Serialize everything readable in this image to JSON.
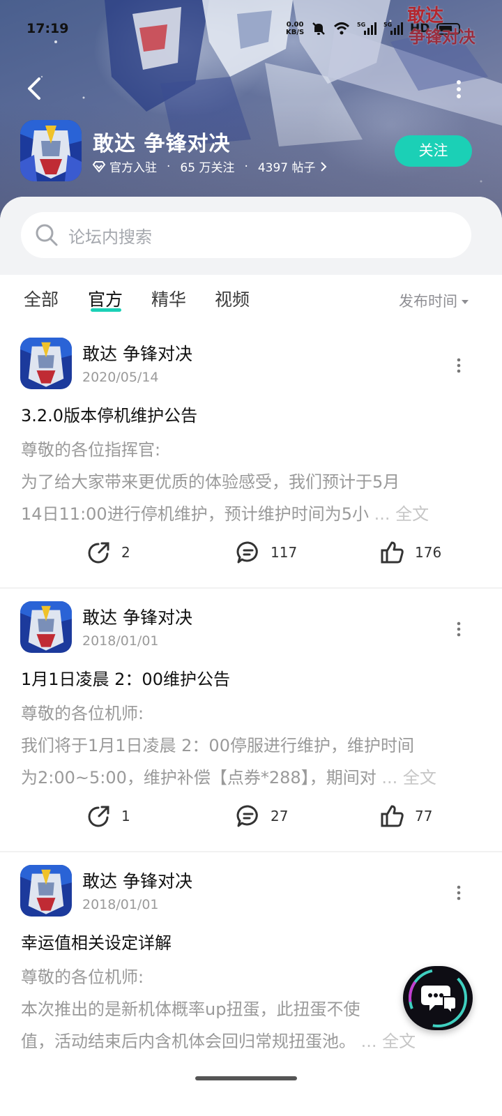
{
  "status": {
    "time": "17:19",
    "net_speed_value": "0.00",
    "net_speed_unit": "KB/S",
    "hd_label": "HD"
  },
  "watermark": {
    "line1": "敢达",
    "line2": "争锋对决"
  },
  "game": {
    "title": "敢达 争锋对决",
    "official_label": "官方入驻",
    "followers": "65 万关注",
    "posts": "4397 帖子",
    "follow_label": "关注"
  },
  "search": {
    "placeholder": "论坛内搜索"
  },
  "tabs": [
    {
      "label": "全部",
      "active": false
    },
    {
      "label": "官方",
      "active": true
    },
    {
      "label": "精华",
      "active": false
    },
    {
      "label": "视频",
      "active": false
    }
  ],
  "sort_label": "发布时间",
  "posts": [
    {
      "author": "敢达 争锋对决",
      "date": "2020/05/14",
      "title": "3.2.0版本停机维护公告",
      "body": [
        "尊敬的各位指挥官:",
        "为了给大家带来更优质的体验感受，我们预计于5月",
        "14日11:00进行停机维护，预计维护时间为5小"
      ],
      "fulltext": "... 全文",
      "shares": "2",
      "comments": "117",
      "likes": "176"
    },
    {
      "author": "敢达 争锋对决",
      "date": "2018/01/01",
      "title": "1月1日凌晨 2：00维护公告",
      "body": [
        "尊敬的各位机师:",
        "我们将于1月1日凌晨 2：00停服进行维护，维护时间",
        "为2:00~5:00，维护补偿【点券*288】，期间对"
      ],
      "fulltext": "... 全文",
      "shares": "1",
      "comments": "27",
      "likes": "77"
    },
    {
      "author": "敢达 争锋对决",
      "date": "2018/01/01",
      "title": "幸运值相关设定详解",
      "body": [
        "尊敬的各位机师:",
        "本次推出的是新机体概率up扭蛋，此扭蛋不使",
        "值，活动结束后内含机体会回归常规扭蛋池。"
      ],
      "fulltext": "... 全文"
    }
  ],
  "colors": {
    "accent": "#1bd0b6",
    "muted_text": "#9a9a9a",
    "watermark": "#b3262e"
  }
}
